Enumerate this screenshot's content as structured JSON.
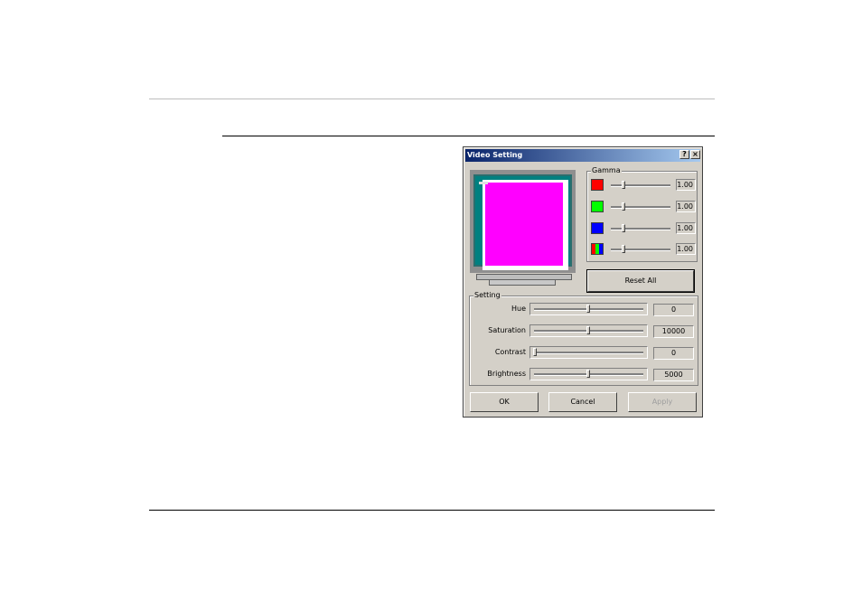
{
  "window": {
    "title": "Video Setting",
    "help": "?",
    "close": "×"
  },
  "gamma": {
    "label": "Gamma",
    "rows": [
      {
        "channel": "red",
        "color": "#ff0000",
        "value": "1.00"
      },
      {
        "channel": "green",
        "color": "#00ff00",
        "value": "1.00"
      },
      {
        "channel": "blue",
        "color": "#0000ff",
        "value": "1.00"
      },
      {
        "channel": "all",
        "color": "rgb",
        "value": "1.00"
      }
    ]
  },
  "reset_button": "Reset All",
  "setting": {
    "label": "Setting",
    "rows": [
      {
        "label": "Hue",
        "value": "0",
        "slider_pct": 50
      },
      {
        "label": "Saturation",
        "value": "10000",
        "slider_pct": 50
      },
      {
        "label": "Contrast",
        "value": "0",
        "slider_pct": 0
      },
      {
        "label": "Brightness",
        "value": "5000",
        "slider_pct": 50
      }
    ]
  },
  "buttons": {
    "ok": "OK",
    "cancel": "Cancel",
    "apply": "Apply"
  },
  "preview": {
    "screen_color": "#ff00ff",
    "desktop_color": "#008080"
  }
}
